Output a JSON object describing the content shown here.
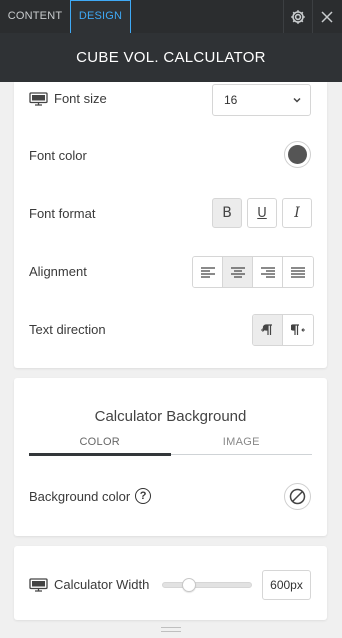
{
  "tabs": {
    "content": "CONTENT",
    "design": "DESIGN"
  },
  "header": {
    "title": "CUBE VOL. CALCULATOR"
  },
  "text_settings": {
    "font_size": {
      "label": "Font size",
      "value": "16"
    },
    "font_color": {
      "label": "Font color",
      "color": "#555555"
    },
    "font_format": {
      "label": "Font format",
      "bold": "B",
      "underline": "U",
      "italic": "I",
      "bold_active": true
    },
    "alignment": {
      "label": "Alignment",
      "options": [
        "left",
        "center",
        "right",
        "justify"
      ],
      "active": "center"
    },
    "text_direction": {
      "label": "Text direction",
      "options": [
        "ltr",
        "rtl"
      ],
      "active": "ltr"
    }
  },
  "background": {
    "title": "Calculator Background",
    "tabs": [
      "COLOR",
      "IMAGE"
    ],
    "active_tab": "COLOR",
    "color_label": "Background color",
    "help": "?"
  },
  "width": {
    "label": "Calculator Width",
    "value": "600px",
    "slider_fraction": 0.25
  },
  "colors": {
    "accent": "#3fa9f5",
    "topbar": "#2b2d2f",
    "header": "#2f3235",
    "panel_bg": "#f0f0f0"
  }
}
